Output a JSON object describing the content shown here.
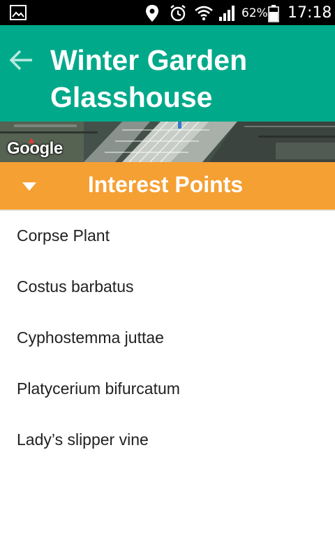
{
  "status_bar": {
    "battery_percent": "62%",
    "time": "17:18",
    "icons": [
      "gallery-icon",
      "location-icon",
      "alarm-icon",
      "wifi-icon",
      "signal-icon",
      "battery-icon"
    ]
  },
  "app_bar": {
    "title": "Winter Garden Glasshouse",
    "back_icon": "arrow-back-icon",
    "background_color": "#00a98a"
  },
  "map": {
    "logo_text": "Google"
  },
  "section": {
    "title": "Interest Points",
    "toggle_icon": "triangle-down-icon",
    "background_color": "#f5a033"
  },
  "interest_points": [
    "Corpse Plant",
    "Costus barbatus",
    "Cyphostemma juttae",
    "Platycerium bifurcatum",
    "Lady’s slipper vine"
  ]
}
